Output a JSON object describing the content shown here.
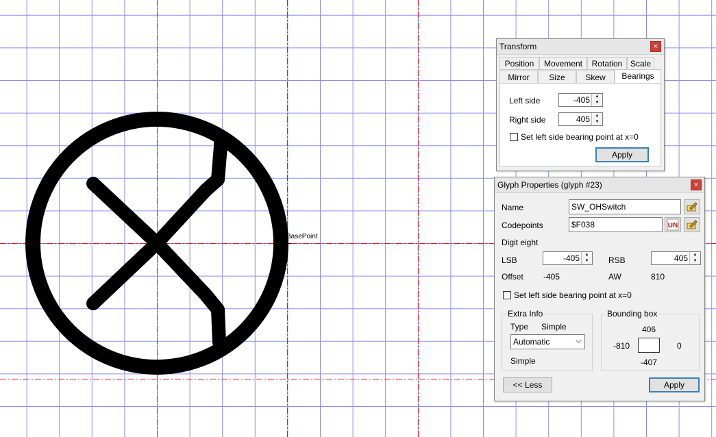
{
  "canvas": {
    "basepoint_label": "BasePoint",
    "grid_color": "#8f8fe8",
    "guide_color": "#d0202a"
  },
  "transform": {
    "title": "Transform",
    "close": "×",
    "tabs_row1": [
      "Position",
      "Movement",
      "Rotation",
      "Scale"
    ],
    "tabs_row2": [
      "Mirror",
      "Size",
      "Skew",
      "Bearings"
    ],
    "active_tab": "Bearings",
    "left_side_label": "Left side",
    "left_side_value": "-405",
    "right_side_label": "Right side",
    "right_side_value": "405",
    "set_lsb_label": "Set left side bearing point at x=0",
    "apply": "Apply"
  },
  "glyph": {
    "title": "Glyph Properties (glyph #23)",
    "close": "×",
    "name_label": "Name",
    "name_value": "SW_OHSwitch",
    "codepoints_label": "Codepoints",
    "codepoints_value": "$F038",
    "unicode_icon_text": "UN",
    "description": "Digit eight",
    "lsb_label": "LSB",
    "lsb_value": "-405",
    "rsb_label": "RSB",
    "rsb_value": "405",
    "offset_label": "Offset",
    "offset_value": "-405",
    "aw_label": "AW",
    "aw_value": "810",
    "set_lsb_label": "Set left side bearing point at x=0",
    "extra_info_label": "Extra Info",
    "type_label": "Type",
    "type_value": "Simple",
    "combo_value": "Automatic",
    "simple_text": "Simple",
    "bbox_label": "Bounding box",
    "bbox_top": "406",
    "bbox_left": "-810",
    "bbox_right": "0",
    "bbox_bottom": "-407",
    "less_button": "<< Less",
    "apply": "Apply"
  },
  "icons": {
    "spin_up": "▲",
    "spin_down": "▼",
    "chevron": "⌵"
  }
}
